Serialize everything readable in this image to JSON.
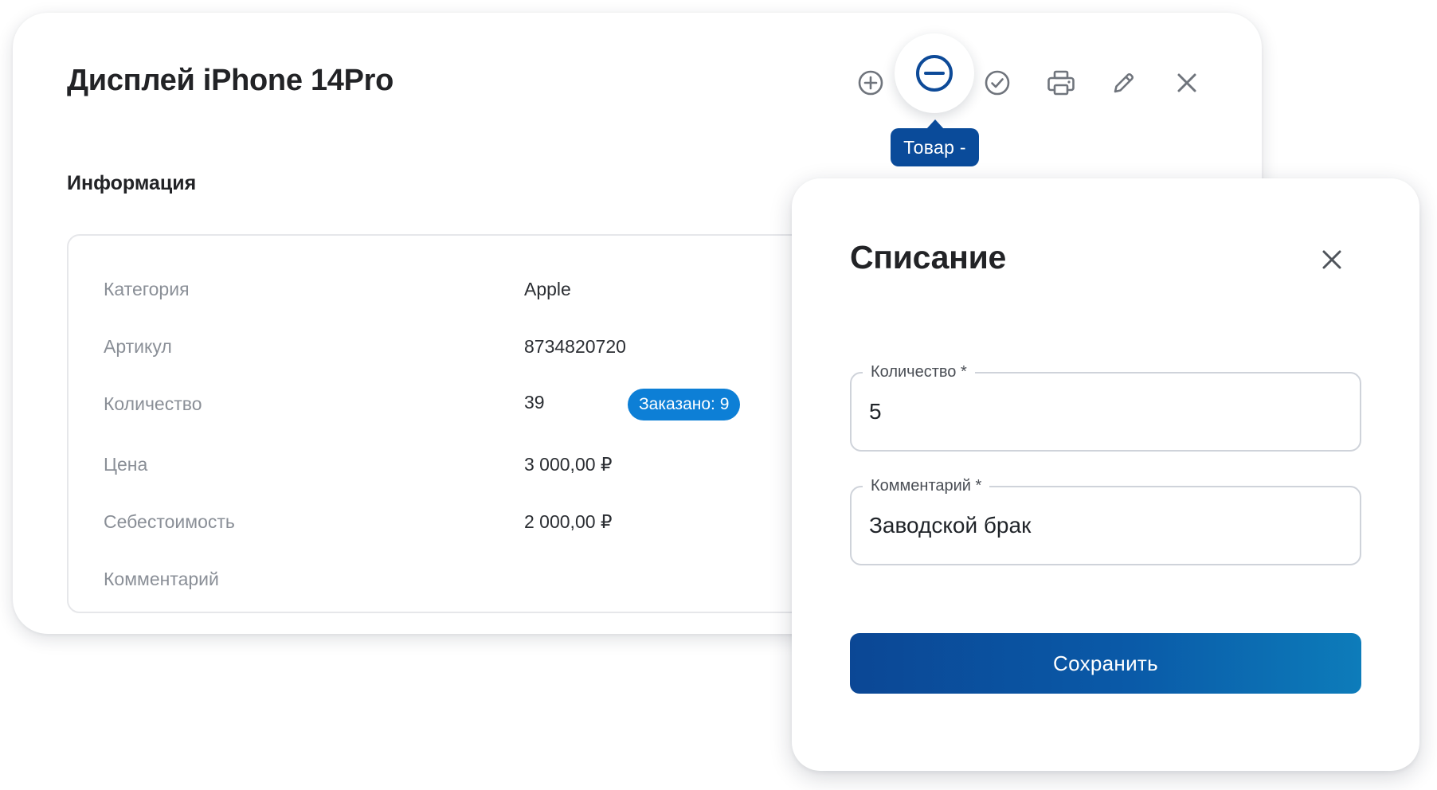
{
  "product": {
    "title": "Дисплей iPhone 14Pro",
    "toolbar": {
      "icons": [
        "plus-circle-icon",
        "minus-circle-icon",
        "check-circle-icon",
        "printer-icon",
        "pencil-icon",
        "close-icon"
      ],
      "tooltip": "Товар -"
    },
    "info": {
      "heading": "Информация",
      "rows": [
        {
          "label": "Категория",
          "value": "Apple"
        },
        {
          "label": "Артикул",
          "value": "8734820720"
        },
        {
          "label": "Количество",
          "value": "39",
          "badge": "Заказано: 9"
        },
        {
          "label": "Цена",
          "value": "3 000,00 ₽"
        },
        {
          "label": "Себестоимость",
          "value": "2 000,00 ₽"
        },
        {
          "label": "Комментарий",
          "value": ""
        }
      ]
    }
  },
  "modal": {
    "title": "Списание",
    "fields": {
      "quantity": {
        "label": "Количество *",
        "value": "5"
      },
      "comment": {
        "label": "Комментарий *",
        "value": "Заводской брак"
      }
    },
    "save_label": "Сохранить"
  },
  "colors": {
    "primary": "#0a4b9a",
    "badge": "#0d7fd6",
    "accent_icon": "#0d4a98",
    "muted_text": "#8a8f97"
  }
}
